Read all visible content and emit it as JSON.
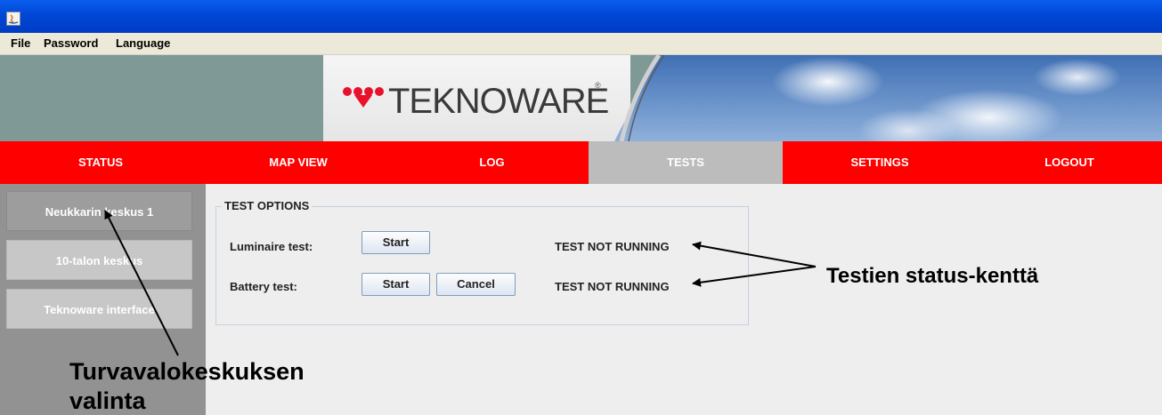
{
  "window": {
    "icon": "java-app-icon"
  },
  "menu": {
    "items": [
      "File",
      "Password",
      "Language"
    ]
  },
  "banner": {
    "logo_text": "TEKNOWARE",
    "logo_reg": "®"
  },
  "nav": {
    "tabs": [
      "STATUS",
      "MAP VIEW",
      "LOG",
      "TESTS",
      "SETTINGS",
      "LOGOUT"
    ],
    "active": "TESTS"
  },
  "sidebar": {
    "items": [
      "Neukkarin keskus 1",
      "10-talon keskus",
      "Teknoware interface"
    ],
    "selected": "Neukkarin keskus 1"
  },
  "test_options": {
    "title": "TEST OPTIONS",
    "luminaire": {
      "label": "Luminaire test:",
      "start": "Start",
      "status": "TEST NOT RUNNING"
    },
    "battery": {
      "label": "Battery test:",
      "start": "Start",
      "cancel": "Cancel",
      "status": "TEST NOT RUNNING"
    }
  },
  "annotations": {
    "status_field": "Testien status-kenttä",
    "center_select_line1": "Turvavalokeskuksen",
    "center_select_line2": "valinta"
  },
  "colors": {
    "nav_red": "#fe0000",
    "nav_active": "#bcbcbc",
    "title_blue": "#0047d6"
  }
}
